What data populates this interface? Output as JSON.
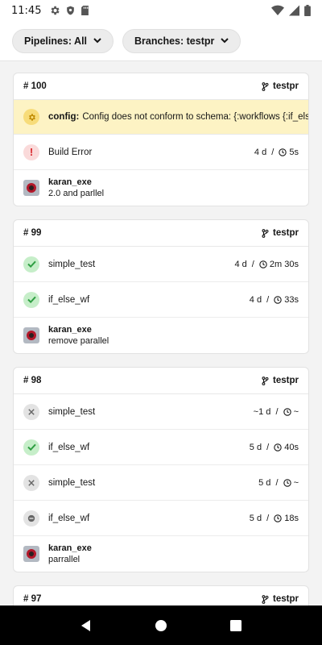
{
  "status_bar": {
    "time": "11:45",
    "left_icons": [
      "gear-icon",
      "shield-icon",
      "sd-card-icon"
    ],
    "right_icons": [
      "wifi-icon",
      "cell-signal-icon",
      "battery-icon"
    ]
  },
  "filters": {
    "pipelines_label": "Pipelines: All",
    "branches_label": "Branches: testpr"
  },
  "pipelines": [
    {
      "number": "# 100",
      "branch": "testpr",
      "banner": {
        "label": "config:",
        "text": "Config does not conform to schema: {:workflows {:if_else"
      },
      "workflows": [
        {
          "name": "Build Error",
          "status": "error",
          "age": "4 d",
          "duration": "5s"
        }
      ],
      "commit": {
        "author": "karan_exe",
        "message": "2.0 and parllel"
      }
    },
    {
      "number": "# 99",
      "branch": "testpr",
      "workflows": [
        {
          "name": "simple_test",
          "status": "success",
          "age": "4 d",
          "duration": "2m 30s"
        },
        {
          "name": "if_else_wf",
          "status": "success",
          "age": "4 d",
          "duration": "33s"
        }
      ],
      "commit": {
        "author": "karan_exe",
        "message": "remove parallel"
      }
    },
    {
      "number": "# 98",
      "branch": "testpr",
      "workflows": [
        {
          "name": "simple_test",
          "status": "canceled",
          "age": "~1 d",
          "duration": "~"
        },
        {
          "name": "if_else_wf",
          "status": "success",
          "age": "5 d",
          "duration": "40s"
        },
        {
          "name": "simple_test",
          "status": "canceled",
          "age": "5 d",
          "duration": "~"
        },
        {
          "name": "if_else_wf",
          "status": "blocked",
          "age": "5 d",
          "duration": "18s"
        }
      ],
      "commit": {
        "author": "karan_exe",
        "message": "parrallel"
      }
    },
    {
      "number": "# 97",
      "branch": "testpr",
      "workflows": []
    }
  ],
  "colors": {
    "success_bg": "#c6eec9",
    "success_fg": "#2e9e42",
    "error_bg": "#fadada",
    "error_fg": "#d8262b",
    "warning_bg": "#fdf3c4",
    "neutral_bg": "#e3e3e3"
  },
  "nav": [
    "back-icon",
    "home-icon",
    "recents-icon"
  ]
}
